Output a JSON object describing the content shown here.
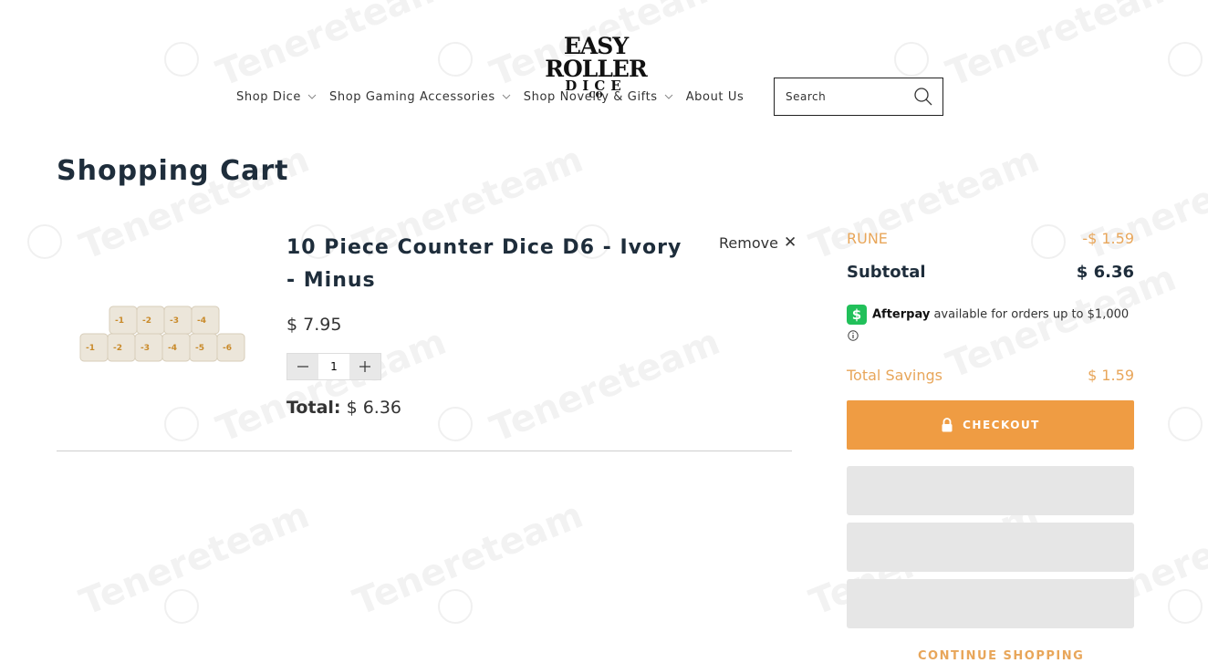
{
  "header": {
    "logo": {
      "line1": "EASY ROLLER",
      "line2": "DICE",
      "line3": "CO"
    },
    "nav": [
      {
        "label": "Shop Dice",
        "dropdown": true
      },
      {
        "label": "Shop Gaming Accessories",
        "dropdown": true
      },
      {
        "label": "Shop Novelty & Gifts",
        "dropdown": true
      },
      {
        "label": "About Us",
        "dropdown": false
      }
    ],
    "search": {
      "placeholder": "Search"
    }
  },
  "page": {
    "title": "Shopping Cart"
  },
  "cart": {
    "item": {
      "name": "10 Piece Counter Dice D6 - Ivory - Minus",
      "price": "$ 7.95",
      "quantity": "1",
      "remove_label": "Remove",
      "total_label": "Total:",
      "total_value": "$ 6.36"
    }
  },
  "summary": {
    "discount": {
      "label": "RUNE",
      "value": "-$ 1.59"
    },
    "subtotal": {
      "label": "Subtotal",
      "value": "$ 6.36"
    },
    "afterpay": {
      "brand": "Afterpay",
      "text": "available for orders up to $1,000"
    },
    "savings": {
      "label": "Total Savings",
      "value": "$ 1.59"
    },
    "checkout_label": "CHECKOUT",
    "continue_label": "CONTINUE SHOPPING"
  },
  "watermark": {
    "text": "Tenereteam"
  },
  "colors": {
    "accent": "#ef9c43",
    "accent_text": "#e8a65a",
    "heading": "#1e2d3b",
    "afterpay": "#21c05a"
  }
}
